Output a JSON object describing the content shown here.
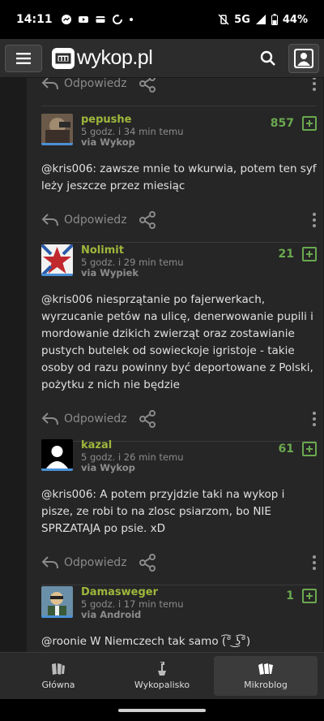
{
  "status_bar": {
    "time": "14:11",
    "network": "5G",
    "battery": "44%"
  },
  "header": {
    "logo_text": "wykop.pl",
    "icons": [
      "menu-icon",
      "search-icon",
      "user-avatar-icon"
    ]
  },
  "posts": [
    {
      "reply_label": "Odpowiedz"
    },
    {
      "author": "pepushe",
      "time": "5 godz. i 34 min temu",
      "via": "via Wykop",
      "votes": "857",
      "text": "@kris006: zawsze mnie to wkurwia, potem ten syf leży jeszcze przez miesiąc",
      "reply_label": "Odpowiedz"
    },
    {
      "author": "Nolimit",
      "time": "5 godz. i 29 min temu",
      "via": "via Wypiek",
      "votes": "21",
      "text": "@kris006 niesprzątanie po fajerwerkach, wyrzucanie petów na ulicę, denerwowanie pupili i mordowanie dzikich zwierząt oraz zostawianie pustych butelek od sowieckoje igristoje - takie osoby od razu powinny być deportowane z Polski, pożytku z nich nie będzie",
      "reply_label": "Odpowiedz"
    },
    {
      "author": "kazal",
      "time": "5 godz. i 26 min temu",
      "via": "via Wykop",
      "votes": "61",
      "text": "@kris006: A potem przyjdzie taki na wykop i pisze, ze robi to na zlosc psiarzom, bo NIE SPRZATAJA po psie. xD",
      "reply_label": "Odpowiedz"
    },
    {
      "author": "Damasweger",
      "time": "5 godz. i 17 min temu",
      "via": "via Android",
      "votes": "1",
      "text": "@roonie W Niemczech tak samo (͡° ͜ʖ͡°)"
    }
  ],
  "bottom_nav": [
    {
      "label": "Główna"
    },
    {
      "label": "Wykopalisko"
    },
    {
      "label": "Mikroblog"
    }
  ],
  "colors": {
    "accent": "#6aa84f",
    "author": "#9fb73c",
    "background": "#262626"
  }
}
